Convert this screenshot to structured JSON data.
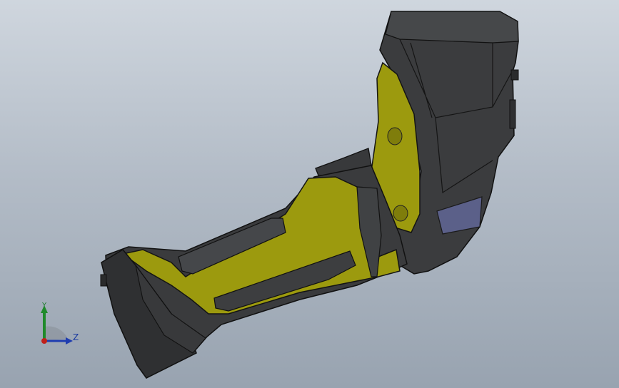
{
  "viewport": {
    "background_top": "#cfd6de",
    "background_bottom": "#98a3b0"
  },
  "model": {
    "body_color": "#3a3b3d",
    "accent_color": "#9c9a0e",
    "window_color": "#5a5f8a",
    "edge_color": "#111111"
  },
  "triad": {
    "y_label": "Y",
    "z_label": "Z",
    "y_color": "#1f8a2a",
    "z_color": "#1f3db0",
    "x_color": "#c0201a"
  }
}
